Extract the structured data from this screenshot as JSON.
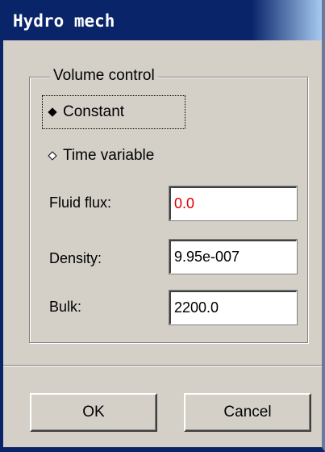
{
  "window": {
    "title": "Hydro mech"
  },
  "volume_control": {
    "group_label": "Volume control",
    "options": [
      {
        "label": "Constant",
        "selected": true
      },
      {
        "label": "Time variable",
        "selected": false
      }
    ]
  },
  "fields": {
    "fluid_flux": {
      "label": "Fluid flux:",
      "value": "0.0",
      "color": "#e00000"
    },
    "density": {
      "label": "Density:",
      "value": "9.95e-007"
    },
    "bulk": {
      "label": "Bulk:",
      "value": "2200.0"
    }
  },
  "buttons": {
    "ok_label": "OK",
    "cancel_label": "Cancel"
  },
  "colors": {
    "titlebar": "#0a246a",
    "dialog_bg": "#d4d0c8"
  }
}
